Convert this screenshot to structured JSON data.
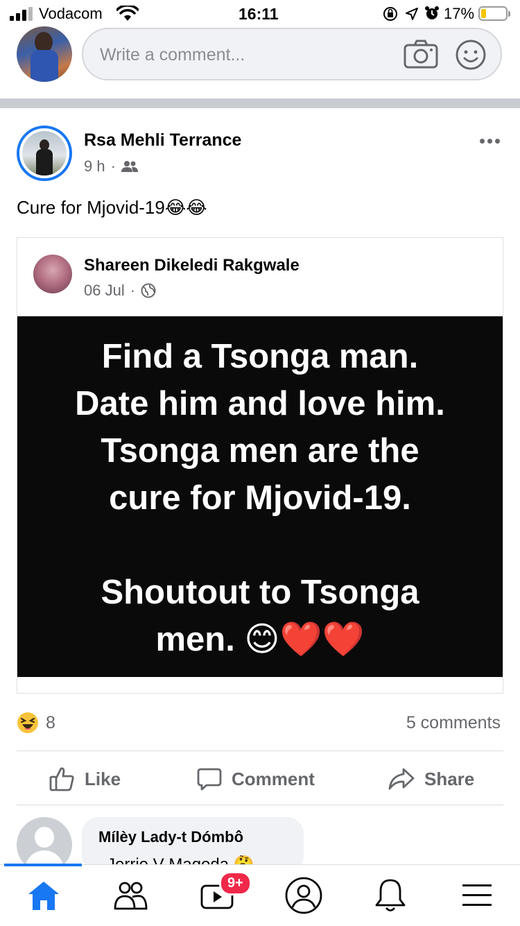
{
  "status_bar": {
    "carrier": "Vodacom",
    "time": "16:11",
    "battery": "17%"
  },
  "composer": {
    "placeholder": "Write a comment..."
  },
  "post": {
    "author": "Rsa Mehli Terrance",
    "time": "9 h",
    "text": "Cure for Mjovid-19😂😂",
    "shared": {
      "author": "Shareen Dikeledi Rakgwale",
      "date": "06 Jul",
      "lines": [
        "Find a Tsonga man.",
        "Date him and love him.",
        "Tsonga men are the",
        "cure for Mjovid-19.",
        "",
        "Shoutout to Tsonga",
        "men. 😊❤️❤️"
      ]
    },
    "reaction_count": "8",
    "comments_count": "5 comments",
    "actions": {
      "like": "Like",
      "comment": "Comment",
      "share": "Share"
    }
  },
  "comment_preview": {
    "author": "Mílèy Lady-t Dómbô",
    "text": "Jerrie V Magoda 🤔"
  },
  "tab_bar": {
    "video_badge": "9+"
  },
  "colors": {
    "accent": "#1877f2",
    "badge": "#f02849"
  }
}
